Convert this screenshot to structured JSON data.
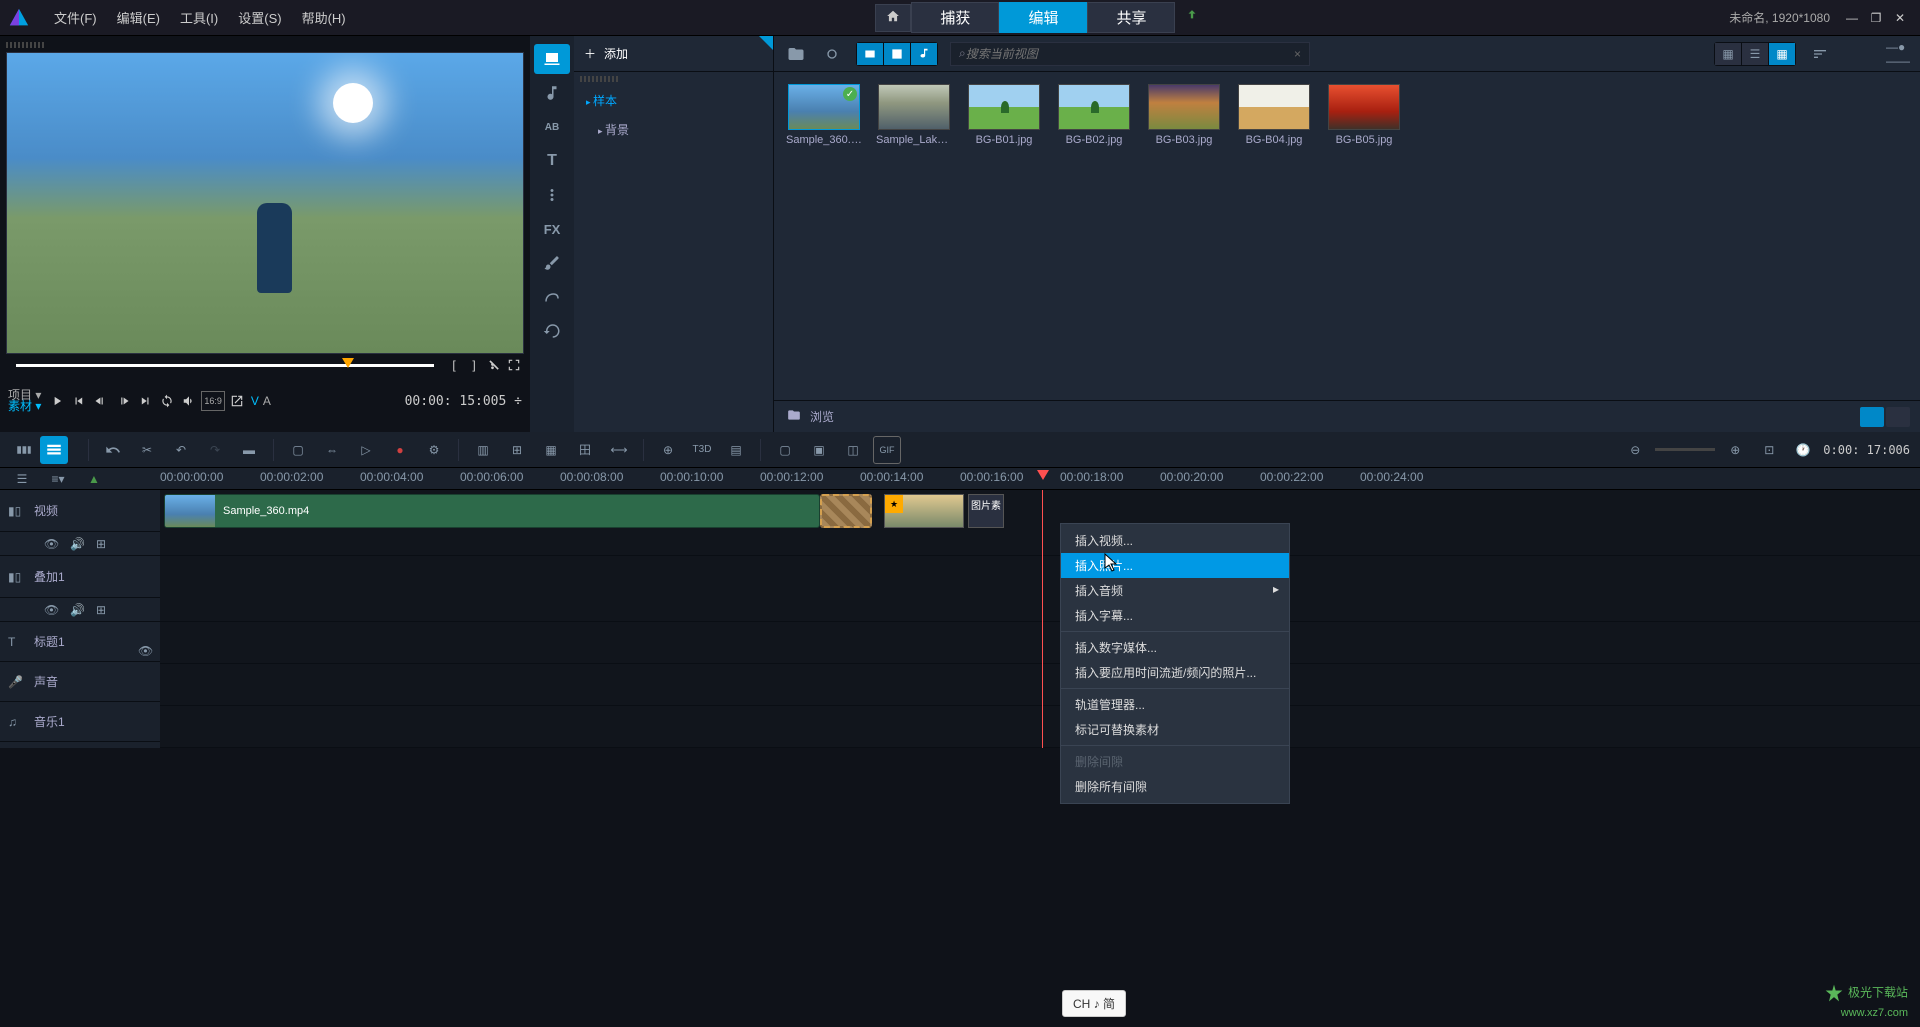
{
  "titlebar": {
    "menus": [
      "文件(F)",
      "编辑(E)",
      "工具(I)",
      "设置(S)",
      "帮助(H)"
    ],
    "tabs": {
      "home": "⌂",
      "capture": "捕获",
      "edit": "编辑",
      "share": "共享"
    },
    "status": "未命名, 1920*1080"
  },
  "preview": {
    "project_labels": [
      "项目 ▾",
      "素材 ▾"
    ],
    "aspect": "16:9",
    "v_label": "V",
    "a_label": "A",
    "timecode": "00:00: 15:005 ÷"
  },
  "library": {
    "add_label": "添加",
    "tree": {
      "root": "样本",
      "sub": "背景"
    },
    "search_placeholder": "搜索当前视图",
    "browse": "浏览",
    "items": [
      {
        "label": "Sample_360.m..."
      },
      {
        "label": "Sample_Lake..."
      },
      {
        "label": "BG-B01.jpg"
      },
      {
        "label": "BG-B02.jpg"
      },
      {
        "label": "BG-B03.jpg"
      },
      {
        "label": "BG-B04.jpg"
      },
      {
        "label": "BG-B05.jpg"
      }
    ],
    "fx_label": "FX",
    "t_label": "T",
    "ab_label": "AB"
  },
  "timeline": {
    "time_display": "0:00: 17:006",
    "ticks": [
      "00:00:00:00",
      "00:00:02:00",
      "00:00:04:00",
      "00:00:06:00",
      "00:00:08:00",
      "00:00:10:00",
      "00:00:12:00",
      "00:00:14:00",
      "00:00:16:00",
      "00:00:18:00",
      "00:00:20:00",
      "00:00:22:00",
      "00:00:24:00"
    ],
    "tracks": {
      "video": "视频",
      "overlay": "叠加1",
      "title": "标题1",
      "sound": "声音",
      "music": "音乐1"
    },
    "clip_label": "Sample_360.mp4",
    "pic_clip_label": "图片素"
  },
  "context_menu": {
    "insert_video": "插入视频...",
    "insert_image": "插入照片...",
    "insert_audio": "插入音频",
    "insert_subtitle": "插入字幕...",
    "insert_digital": "插入数字媒体...",
    "insert_timelapse": "插入要应用时间流逝/频闪的照片...",
    "track_manager": "轨道管理器...",
    "mark_replaceable": "标记可替换素材",
    "delete_gap": "删除间隙",
    "delete_all_gaps": "删除所有间隙"
  },
  "ime": "CH ♪ 简",
  "watermark": {
    "name": "极光下载站",
    "url": "www.xz7.com"
  }
}
